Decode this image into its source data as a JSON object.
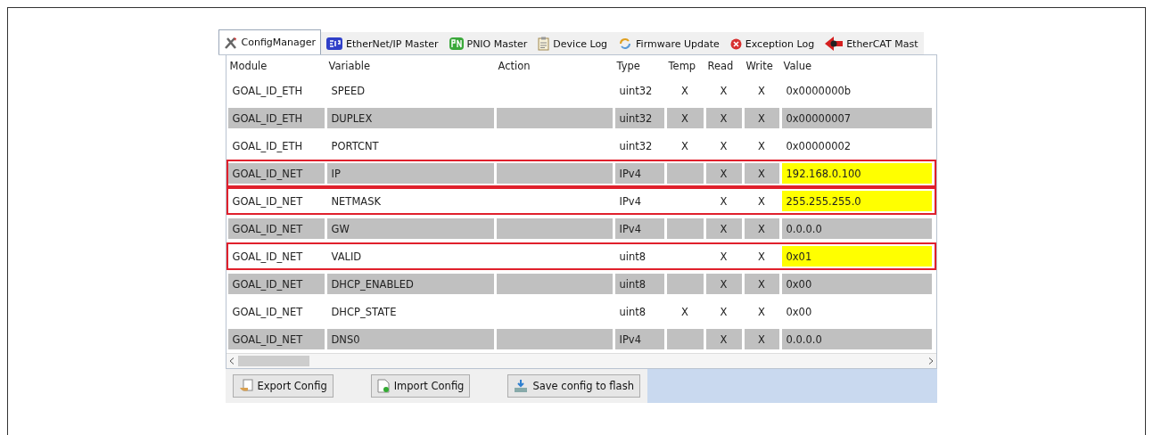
{
  "tabs": [
    {
      "label": "ConfigManager",
      "selected": true
    },
    {
      "label": "EtherNet/IP Master",
      "selected": false
    },
    {
      "label": "PNIO Master",
      "selected": false
    },
    {
      "label": "Device Log",
      "selected": false
    },
    {
      "label": "Firmware Update",
      "selected": false
    },
    {
      "label": "Exception Log",
      "selected": false
    },
    {
      "label": "EtherCAT Mast",
      "selected": false
    }
  ],
  "table": {
    "columns": [
      "Module",
      "Variable",
      "Action",
      "Type",
      "Temp",
      "Read",
      "Write",
      "Value"
    ],
    "rows": [
      {
        "module": "GOAL_ID_ETH",
        "variable": "SPEED",
        "type": "uint32",
        "temp": "X",
        "read": "X",
        "write": "X",
        "value": "0x0000000b",
        "shaded": false,
        "highlighted": false
      },
      {
        "module": "GOAL_ID_ETH",
        "variable": "DUPLEX",
        "type": "uint32",
        "temp": "X",
        "read": "X",
        "write": "X",
        "value": "0x00000007",
        "shaded": true,
        "highlighted": false
      },
      {
        "module": "GOAL_ID_ETH",
        "variable": "PORTCNT",
        "type": "uint32",
        "temp": "X",
        "read": "X",
        "write": "X",
        "value": "0x00000002",
        "shaded": false,
        "highlighted": false
      },
      {
        "module": "GOAL_ID_NET",
        "variable": "IP",
        "type": "IPv4",
        "read": "X",
        "write": "X",
        "value": "192.168.0.100",
        "shaded": true,
        "highlighted": true
      },
      {
        "module": "GOAL_ID_NET",
        "variable": "NETMASK",
        "type": "IPv4",
        "read": "X",
        "write": "X",
        "value": "255.255.255.0",
        "shaded": false,
        "highlighted": true
      },
      {
        "module": "GOAL_ID_NET",
        "variable": "GW",
        "type": "IPv4",
        "read": "X",
        "write": "X",
        "value": "0.0.0.0",
        "shaded": true,
        "highlighted": false
      },
      {
        "module": "GOAL_ID_NET",
        "variable": "VALID",
        "type": "uint8",
        "read": "X",
        "write": "X",
        "value": "0x01",
        "shaded": false,
        "highlighted": true
      },
      {
        "module": "GOAL_ID_NET",
        "variable": "DHCP_ENABLED",
        "type": "uint8",
        "read": "X",
        "write": "X",
        "value": "0x00",
        "shaded": true,
        "highlighted": false
      },
      {
        "module": "GOAL_ID_NET",
        "variable": "DHCP_STATE",
        "type": "uint8",
        "temp": "X",
        "read": "X",
        "write": "X",
        "value": "0x00",
        "shaded": false,
        "highlighted": false
      },
      {
        "module": "GOAL_ID_NET",
        "variable": "DNS0",
        "type": "IPv4",
        "read": "X",
        "write": "X",
        "value": "0.0.0.0",
        "shaded": true,
        "highlighted": false
      }
    ]
  },
  "buttons": [
    {
      "label": "Export Config"
    },
    {
      "label": "Import Config"
    },
    {
      "label": "Save config to flash"
    }
  ]
}
